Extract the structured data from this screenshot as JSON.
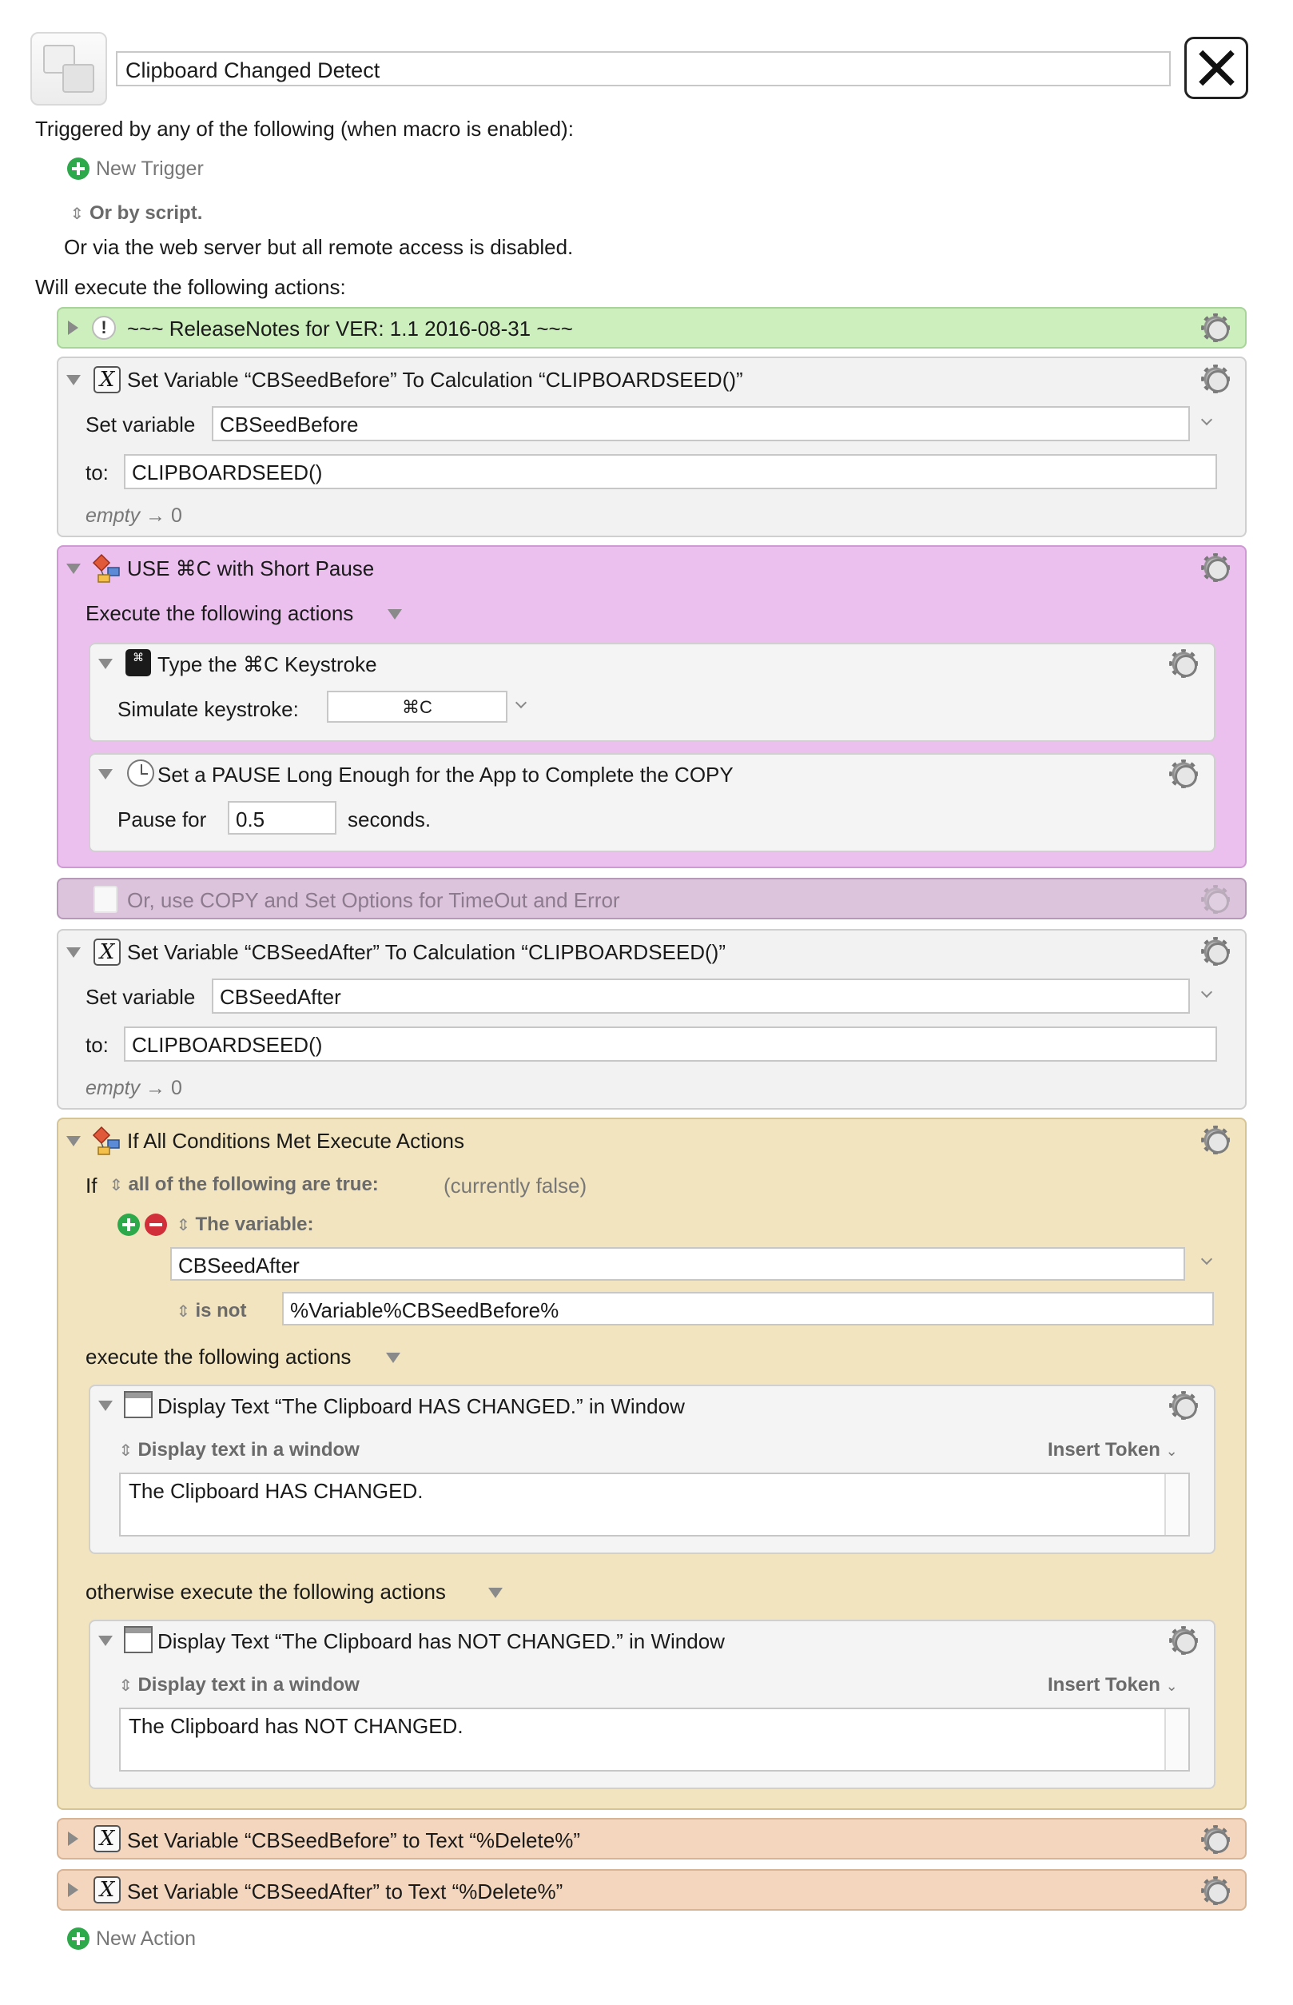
{
  "macro": {
    "name": "Clipboard Changed Detect"
  },
  "triggers": {
    "heading": "Triggered by any of the following (when macro is enabled):",
    "new_trigger": "New Trigger",
    "or_by_script": "Or by script.",
    "web_server": "Or via the web server but all remote access is disabled."
  },
  "actions_heading": "Will execute the following actions:",
  "actions": {
    "release_notes": {
      "title": "~~~ ReleaseNotes for VER: 1.1    2016-08-31 ~~~"
    },
    "set_before": {
      "title": "Set Variable “CBSeedBefore” To Calculation “CLIPBOARDSEED()”",
      "set_variable_label": "Set variable",
      "variable": "CBSeedBefore",
      "to_label": "to:",
      "value": "CLIPBOARDSEED()",
      "result_empty": "empty",
      "result_arrow": "→ 0"
    },
    "use_cmd_c": {
      "title": "USE ⌘C with Short Pause",
      "execute_label": "Execute the following actions",
      "keystroke": {
        "title": "Type the ⌘C Keystroke",
        "simulate_label": "Simulate keystroke:",
        "value": "⌘C"
      },
      "pause": {
        "title": "Set a PAUSE Long Enough for the App to Complete the COPY",
        "pause_for_label": "Pause for",
        "value": "0.5",
        "seconds_label": "seconds."
      }
    },
    "copy_disabled": {
      "title": "Or, use COPY and Set Options for TimeOut and Error"
    },
    "set_after": {
      "title": "Set Variable “CBSeedAfter” To Calculation “CLIPBOARDSEED()”",
      "set_variable_label": "Set variable",
      "variable": "CBSeedAfter",
      "to_label": "to:",
      "value": "CLIPBOARDSEED()",
      "result_empty": "empty",
      "result_arrow": "→ 0"
    },
    "if_block": {
      "title": "If All Conditions Met Execute Actions",
      "if_label": "If",
      "all_following": "all of the following are true:",
      "currently": "(currently false)",
      "the_variable": "The variable:",
      "variable": "CBSeedAfter",
      "is_not_label": "is not",
      "compare_value": "%Variable%CBSeedBefore%",
      "then_label": "execute the following actions",
      "then_action": {
        "title": "Display Text “The Clipboard HAS CHANGED.” in Window",
        "mode": "Display text in a window",
        "insert_token": "Insert Token",
        "text": "The Clipboard HAS CHANGED."
      },
      "else_label": "otherwise execute the following actions",
      "else_action": {
        "title": "Display Text “The Clipboard has NOT CHANGED.” in Window",
        "mode": "Display text in a window",
        "insert_token": "Insert Token",
        "text": "The Clipboard has NOT CHANGED."
      }
    },
    "delete_before": {
      "title": "Set Variable “CBSeedBefore” to Text “%Delete%”"
    },
    "delete_after": {
      "title": "Set Variable “CBSeedAfter” to Text “%Delete%”"
    }
  },
  "new_action": "New Action",
  "colors": {
    "release_notes": "#cdeebd",
    "set_variable": "#f2f2f2",
    "group": "#ebc0ee",
    "disabled": "#dcc4dd",
    "if_then": "#f2e4be",
    "set_variable_text": "#f3d6bd",
    "add": "#2da84b",
    "remove": "#d12f3a"
  }
}
